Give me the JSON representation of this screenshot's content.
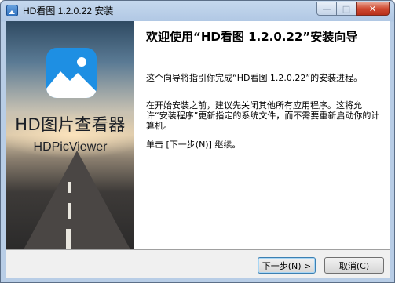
{
  "window": {
    "title": "HD看图 1.2.0.22 安装",
    "minimize_glyph": "—",
    "maximize_glyph": "□",
    "close_glyph": "✕"
  },
  "banner": {
    "app_name": "HD图片查看器",
    "app_name_en": "HDPicViewer",
    "icon": "photo-landscape-icon"
  },
  "content": {
    "heading": "欢迎使用“HD看图 1.2.0.22”安装向导",
    "paragraph1": "这个向导将指引你完成“HD看图 1.2.0.22”的安装进程。",
    "paragraph2": "在开始安装之前，建议先关闭其他所有应用程序。这将允许“安装程序”更新指定的系统文件，而不需要重新启动你的计算机。",
    "paragraph3": "单击 [下一步(N)] 继续。"
  },
  "buttons": {
    "next_label": "下一步(N) >",
    "cancel_label": "取消(C)"
  },
  "colors": {
    "icon_blue": "#1e8fe3",
    "titlebar": "#b8cde6",
    "close_red": "#cf4a32"
  }
}
